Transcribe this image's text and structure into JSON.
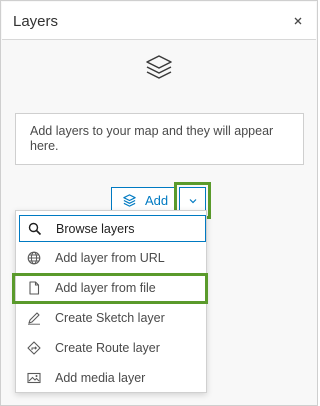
{
  "header": {
    "title": "Layers",
    "close_icon": "close-icon"
  },
  "empty_state": {
    "icon": "layers-icon",
    "message": "Add layers to your map and they will appear here."
  },
  "add_button": {
    "icon": "layers-icon",
    "label": "Add",
    "dropdown_icon": "chevron-down-icon"
  },
  "menu": {
    "items": [
      {
        "icon": "search-icon",
        "label": "Browse layers"
      },
      {
        "icon": "globe-icon",
        "label": "Add layer from URL"
      },
      {
        "icon": "file-icon",
        "label": "Add layer from file"
      },
      {
        "icon": "sketch-icon",
        "label": "Create Sketch layer"
      },
      {
        "icon": "route-icon",
        "label": "Create Route layer"
      },
      {
        "icon": "image-icon",
        "label": "Add media layer"
      }
    ]
  },
  "colors": {
    "accent": "#007ac2",
    "highlight": "#5a9a2b"
  }
}
